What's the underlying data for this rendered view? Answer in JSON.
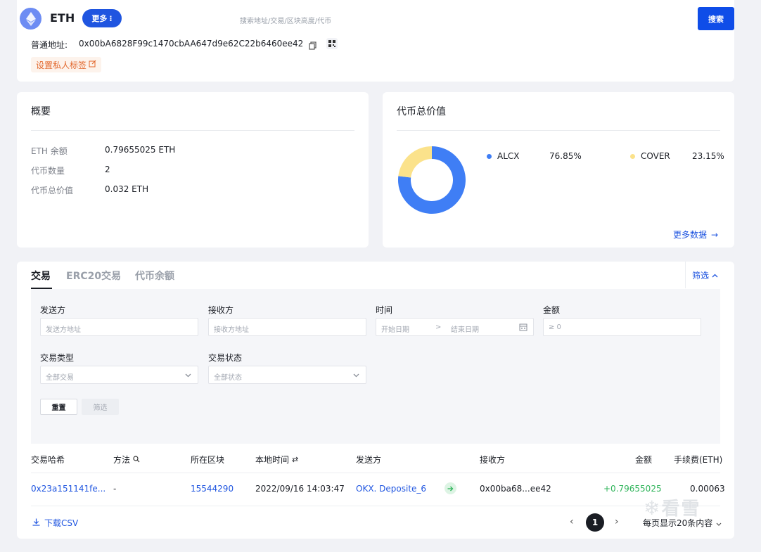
{
  "header": {
    "coin": "ETH",
    "more_label": "更多",
    "search_placeholder": "搜索地址/交易/区块高度/代币",
    "search_button": "搜索",
    "address_label": "普通地址:",
    "address": "0x00bA6828F99c1470cbAA647d9e62C22b6460ee42",
    "private_tag_label": "设置私人标签"
  },
  "overview": {
    "title": "概要",
    "rows": [
      {
        "label": "ETH 余额",
        "value": "0.79655025 ETH"
      },
      {
        "label": "代币数量",
        "value": "2"
      },
      {
        "label": "代币总价值",
        "value": "0.032 ETH"
      }
    ]
  },
  "token_value": {
    "title": "代币总价值",
    "more_data": "更多数据",
    "legend": [
      {
        "name": "ALCX",
        "pct": "76.85%",
        "color": "#3f7ef5"
      },
      {
        "name": "COVER",
        "pct": "23.15%",
        "color": "#fbe28b"
      }
    ]
  },
  "chart_data": {
    "type": "pie",
    "categories": [
      "ALCX",
      "COVER"
    ],
    "values": [
      76.85,
      23.15
    ],
    "colors": [
      "#3f7ef5",
      "#fbe28b"
    ]
  },
  "tabs": [
    "交易",
    "ERC20交易",
    "代币余额"
  ],
  "filter": {
    "toggle_label": "筛选",
    "sender_label": "发送方",
    "sender_placeholder": "发送方地址",
    "receiver_label": "接收方",
    "receiver_placeholder": "接收方地址",
    "time_label": "时间",
    "start_placeholder": "开始日期",
    "end_placeholder": "结束日期",
    "range_sep": ">",
    "amount_label": "金额",
    "amount_placeholder": "≥ 0",
    "type_label": "交易类型",
    "type_value": "全部交易",
    "status_label": "交易状态",
    "status_value": "全部状态",
    "reset_button": "重置",
    "apply_button": "筛选"
  },
  "table": {
    "headers": {
      "hash": "交易哈希",
      "method": "方法",
      "block": "所在区块",
      "time": "本地时间",
      "from": "发送方",
      "to": "接收方",
      "amount": "金额",
      "fee": "手续费(ETH)"
    },
    "rows": [
      {
        "hash": "0x23a151141fe...",
        "method": "-",
        "block": "15544290",
        "time": "2022/09/16 14:03:47",
        "from": "OKX. Deposite_6",
        "to": "0x00ba68...ee42",
        "amount": "+0.79655025",
        "fee": "0.00063"
      }
    ]
  },
  "footer": {
    "download_csv": "下载CSV",
    "current_page": "1",
    "page_size": "每页显示20条内容"
  },
  "watermark": "看雪"
}
